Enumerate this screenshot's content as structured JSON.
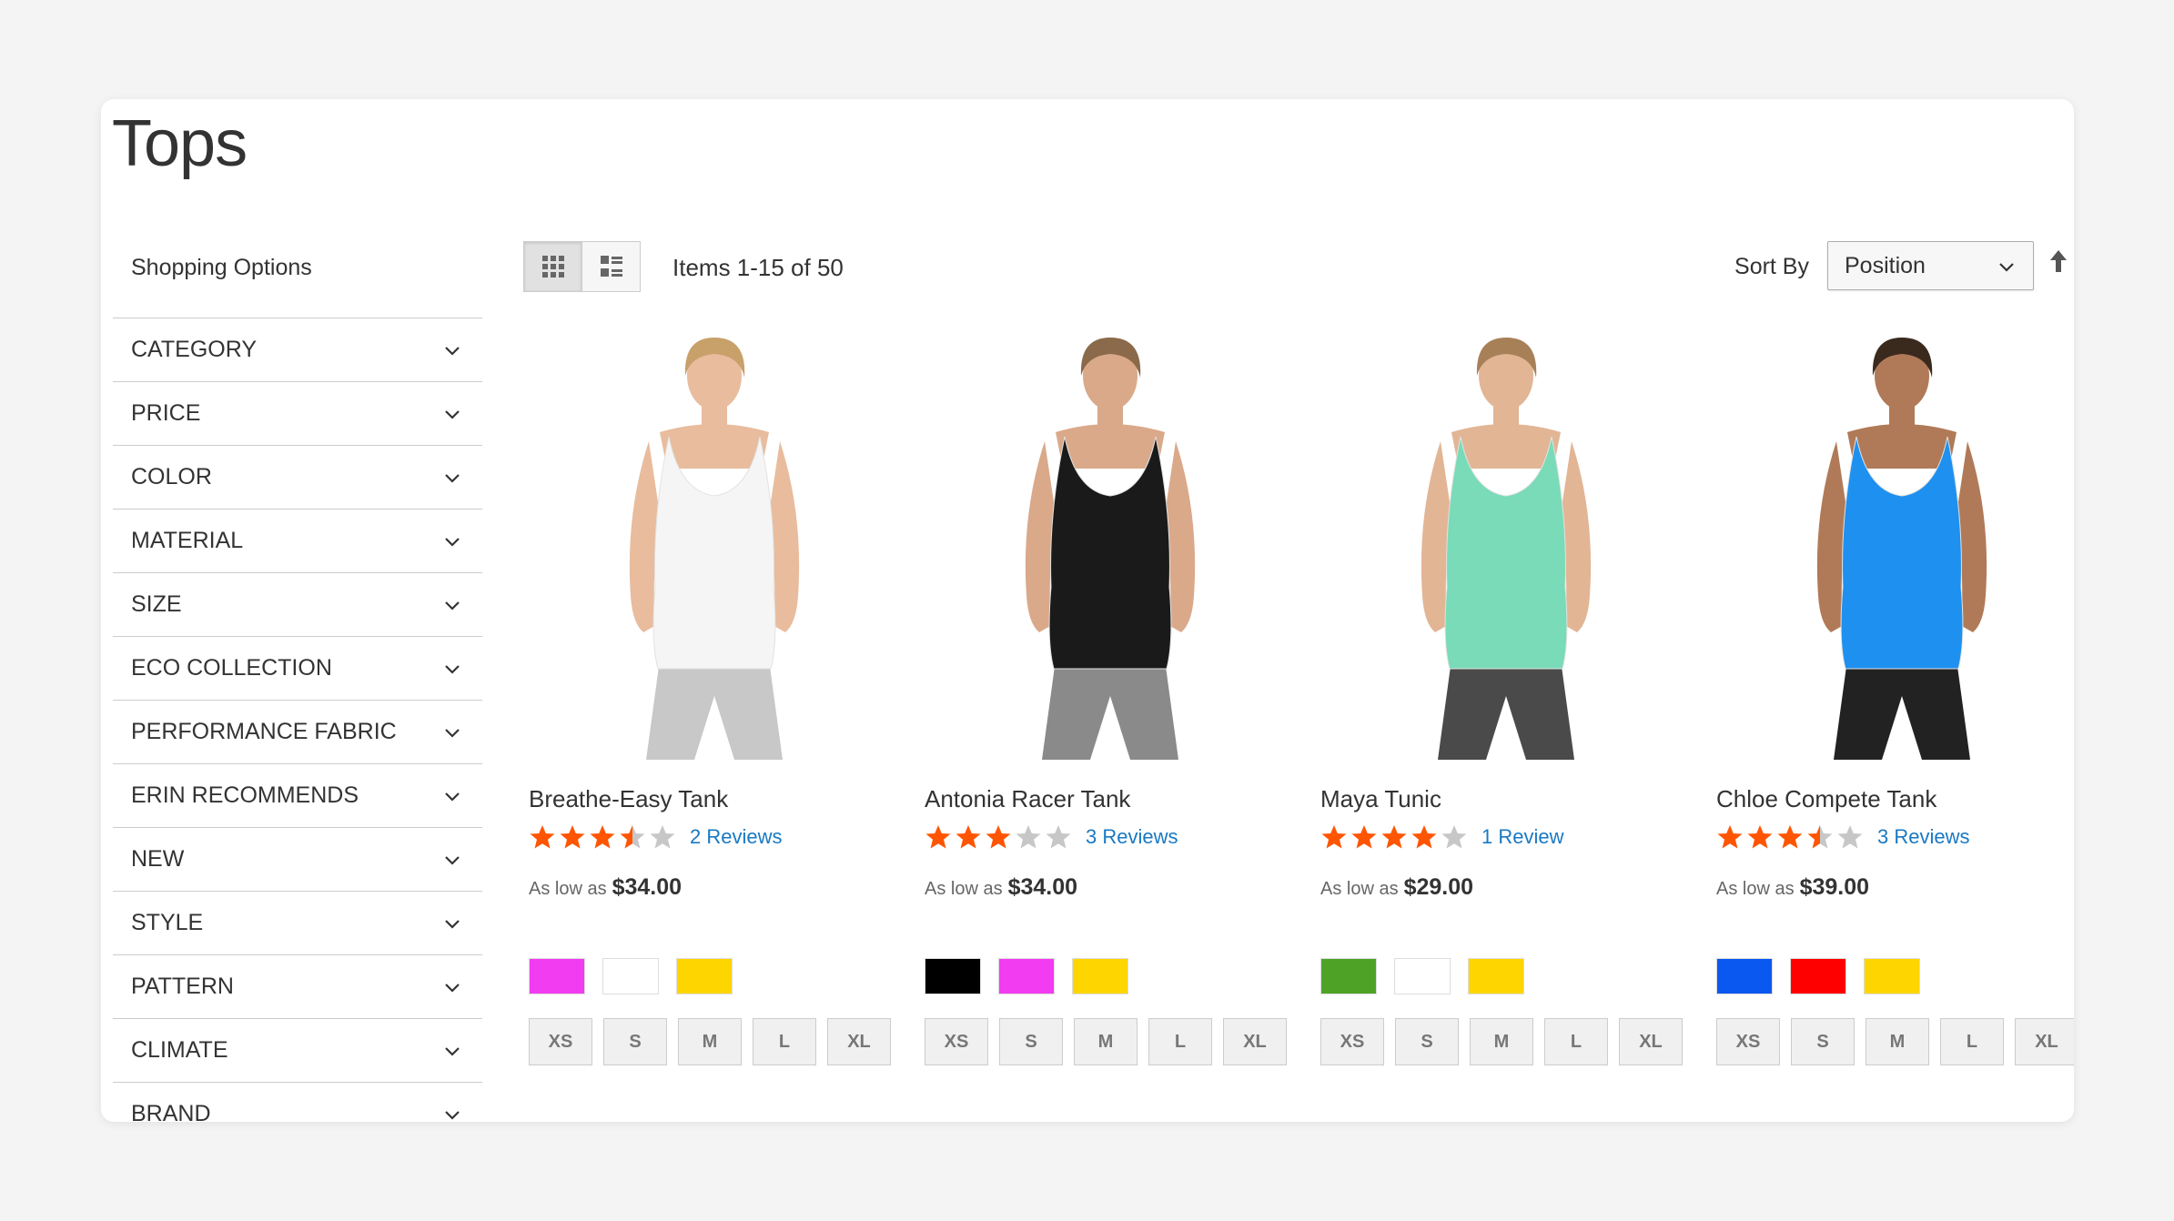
{
  "page": {
    "title": "Tops"
  },
  "sidebar": {
    "title": "Shopping Options",
    "filters": [
      "CATEGORY",
      "PRICE",
      "COLOR",
      "MATERIAL",
      "SIZE",
      "ECO COLLECTION",
      "PERFORMANCE FABRIC",
      "ERIN RECOMMENDS",
      "NEW",
      "STYLE",
      "PATTERN",
      "CLIMATE",
      "BRAND"
    ]
  },
  "toolbar": {
    "items_count": "Items 1-15 of 50",
    "sort_label": "Sort By",
    "sort_value": "Position",
    "view_modes": [
      "grid-icon",
      "list-icon"
    ]
  },
  "products": [
    {
      "name": "Breathe-Easy Tank",
      "rating": 3.5,
      "reviews": "2 Reviews",
      "price_prefix": "As low as",
      "price": "$34.00",
      "swatches": [
        "#f13cf1",
        "#ffffff",
        "#ffd500"
      ],
      "sizes": [
        "XS",
        "S",
        "M",
        "L",
        "XL"
      ],
      "top_color": "#f5f5f5",
      "bottom_color": "#c8c8c8",
      "skin": "#e8bc9d",
      "hair": "#c8a06a"
    },
    {
      "name": "Antonia Racer Tank",
      "rating": 3,
      "reviews": "3 Reviews",
      "price_prefix": "As low as",
      "price": "$34.00",
      "swatches": [
        "#000000",
        "#f13cf1",
        "#ffd500"
      ],
      "sizes": [
        "XS",
        "S",
        "M",
        "L",
        "XL"
      ],
      "top_color": "#1a1a1a",
      "bottom_color": "#8a8a8a",
      "skin": "#d9a98a",
      "hair": "#8a6a4a"
    },
    {
      "name": "Maya Tunic",
      "rating": 4,
      "reviews": "1 Review",
      "price_prefix": "As low as",
      "price": "$29.00",
      "swatches": [
        "#4ea327",
        "#ffffff",
        "#ffd500"
      ],
      "sizes": [
        "XS",
        "S",
        "M",
        "L",
        "XL"
      ],
      "top_color": "#79dbb8",
      "bottom_color": "#4a4a4a",
      "skin": "#e2b595",
      "hair": "#a88058"
    },
    {
      "name": "Chloe Compete Tank",
      "rating": 3.5,
      "reviews": "3 Reviews",
      "price_prefix": "As low as",
      "price": "$39.00",
      "swatches": [
        "#0a58f0",
        "#ff0000",
        "#ffd500"
      ],
      "sizes": [
        "XS",
        "S",
        "M",
        "L",
        "XL"
      ],
      "top_color": "#1e90ef",
      "bottom_color": "#222222",
      "skin": "#b07a58",
      "hair": "#3a2a1e"
    }
  ],
  "colors": {
    "star_filled": "#ff5501",
    "star_empty": "#c7c7c7",
    "link": "#1979c3"
  }
}
